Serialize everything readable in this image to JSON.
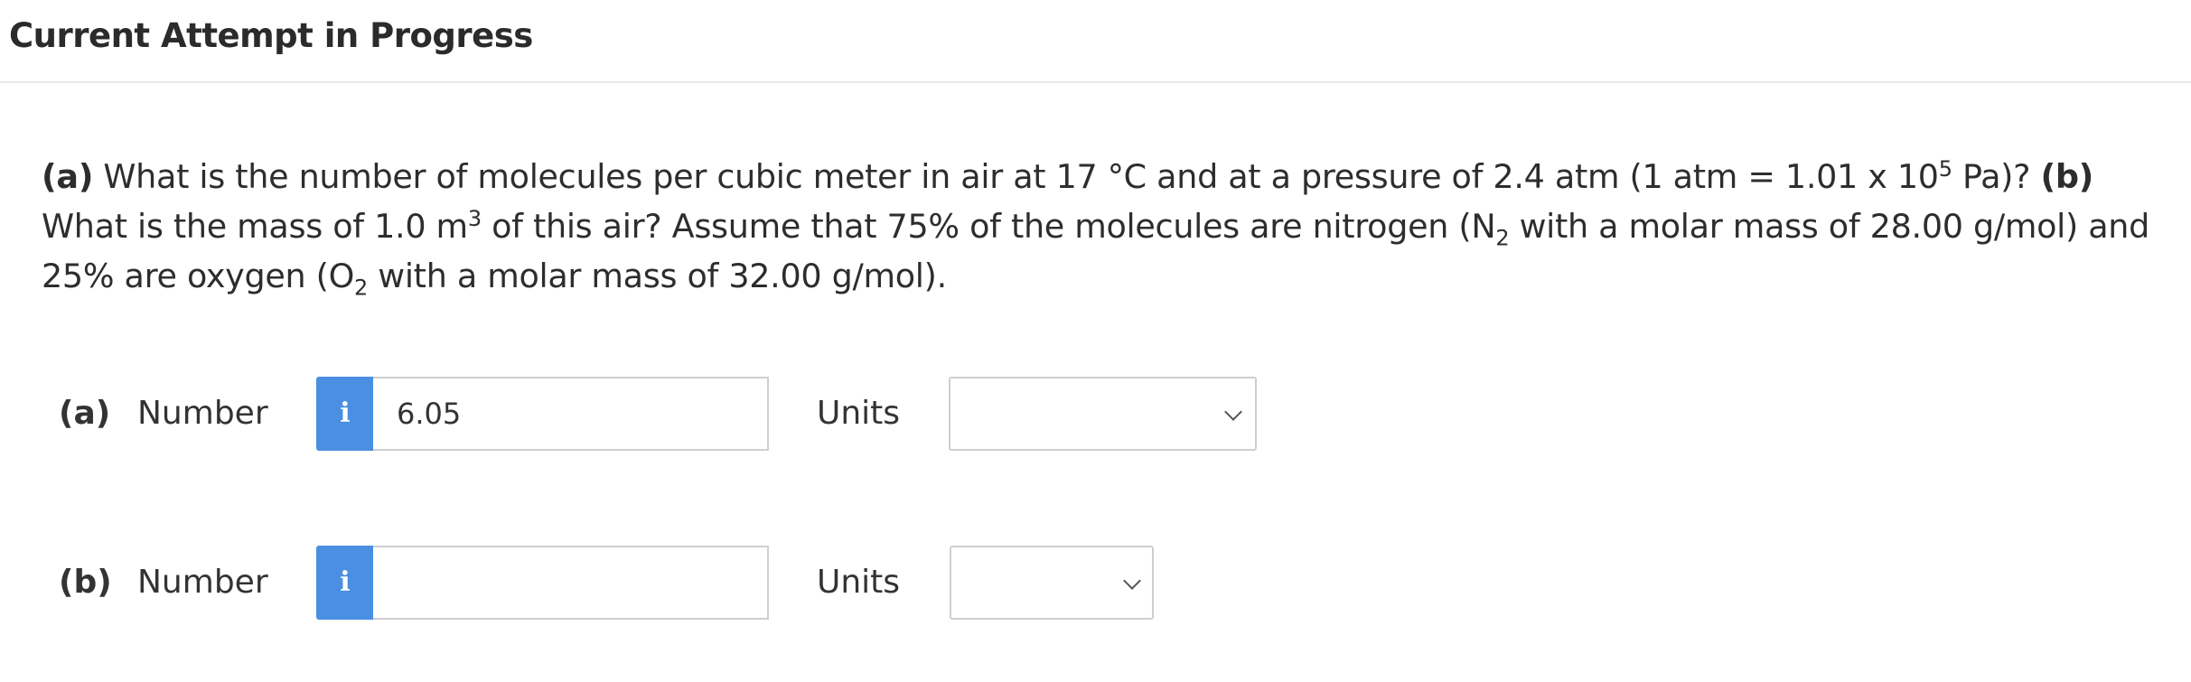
{
  "header": {
    "title": "Current Attempt in Progress"
  },
  "question": {
    "a_tag": "(a)",
    "text1": " What is the number of molecules per cubic meter in air at 17 °C and at a pressure of 2.4 atm (1 atm = 1.01 x 10",
    "exp1": "5",
    "text2": " Pa)? ",
    "b_tag": "(b)",
    "text3": " What is the mass of 1.0 m",
    "exp2": "3",
    "text4": " of this air? Assume that 75% of the molecules are nitrogen (N",
    "sub1": "2",
    "text5": " with a molar mass of 28.00 g/mol) and 25% are oxygen (O",
    "sub2": "2",
    "text6": " with a molar mass of 32.00 g/mol)."
  },
  "parts": [
    {
      "label": "(a)",
      "number_label": "Number",
      "info_icon": "i",
      "value": "6.05",
      "units_label": "Units",
      "units_selected": ""
    },
    {
      "label": "(b)",
      "number_label": "Number",
      "info_icon": "i",
      "value": "",
      "units_label": "Units",
      "units_selected": ""
    }
  ],
  "colors": {
    "info_button": "#4a8fe2",
    "border": "#cfcfcf"
  }
}
